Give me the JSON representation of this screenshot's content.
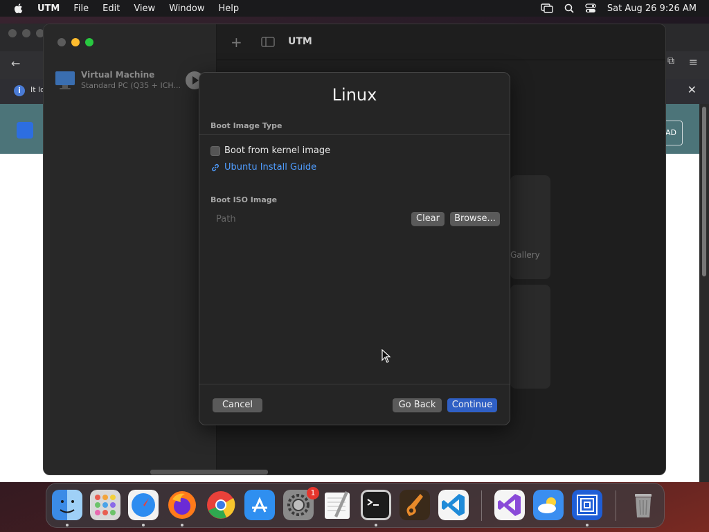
{
  "menubar": {
    "app_name": "UTM",
    "items": [
      "File",
      "Edit",
      "View",
      "Window",
      "Help"
    ],
    "clock": "Sat Aug 26  9:26 AM"
  },
  "background_browser": {
    "info_text": "It lo",
    "button_text": "AD"
  },
  "utm_window": {
    "title": "UTM",
    "vm": {
      "name": "Virtual Machine",
      "subtitle": "Standard PC (Q35 + ICH..."
    },
    "gallery_text": "Gallery"
  },
  "dialog": {
    "title": "Linux",
    "boot_image_type_label": "Boot Image Type",
    "boot_kernel_label": "Boot from kernel image",
    "boot_kernel_checked": false,
    "guide_link": "Ubuntu Install Guide",
    "boot_iso_label": "Boot ISO Image",
    "path_placeholder": "Path",
    "clear_label": "Clear",
    "browse_label": "Browse...",
    "cancel_label": "Cancel",
    "go_back_label": "Go Back",
    "continue_label": "Continue"
  },
  "dock": {
    "settings_badge": "1",
    "apps": [
      "finder",
      "launchpad",
      "safari",
      "firefox",
      "chrome",
      "app-store",
      "system-settings",
      "textedit",
      "terminal",
      "garageband",
      "vscode",
      "visual-studio",
      "weather",
      "utm",
      "trash"
    ]
  },
  "colors": {
    "accent": "#2f5fc4",
    "link": "#4f9dff",
    "traffic_red": "#ff5f57",
    "traffic_yellow": "#febc2e",
    "traffic_green": "#28c840"
  }
}
